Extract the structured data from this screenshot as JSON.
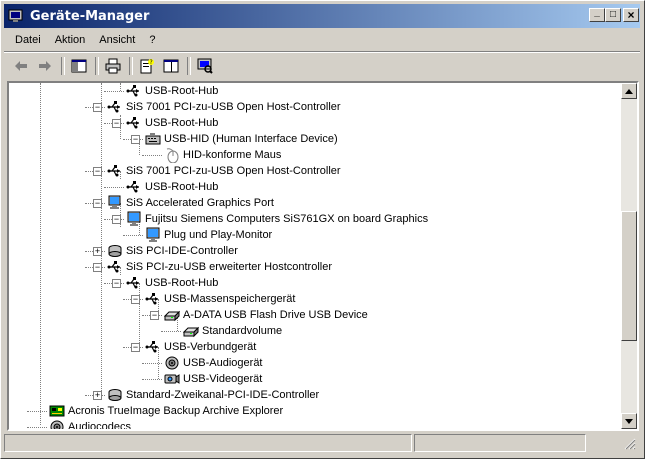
{
  "window": {
    "title": "Geräte-Manager"
  },
  "window_buttons": {
    "minimize": "_",
    "maximize": "□",
    "close": "×"
  },
  "menu": [
    "Datei",
    "Aktion",
    "Ansicht",
    "?"
  ],
  "toolbar": {
    "buttons": [
      "back-arrow-icon",
      "forward-arrow-icon",
      "show-hide-console-tree-icon",
      "print-icon",
      "properties-icon",
      "help-icon",
      "scan-hardware-icon"
    ]
  },
  "tree": {
    "rows": [
      {
        "label": "USB-Root-Hub",
        "icon": "usb-icon"
      },
      {
        "label": "SiS 7001 PCI-zu-USB Open Host-Controller",
        "icon": "usb-icon"
      },
      {
        "label": "USB-Root-Hub",
        "icon": "usb-icon"
      },
      {
        "label": "USB-HID (Human Interface Device)",
        "icon": "hid-icon"
      },
      {
        "label": "HID-konforme Maus",
        "icon": "mouse-icon"
      },
      {
        "label": "SiS 7001 PCI-zu-USB Open Host-Controller",
        "icon": "usb-icon"
      },
      {
        "label": "USB-Root-Hub",
        "icon": "usb-icon"
      },
      {
        "label": "SiS Accelerated Graphics Port",
        "icon": "agp-icon"
      },
      {
        "label": "Fujitsu Siemens Computers SiS761GX on board Graphics",
        "icon": "monitor-icon"
      },
      {
        "label": "Plug und Play-Monitor",
        "icon": "monitor-icon"
      },
      {
        "label": "SiS PCI-IDE-Controller",
        "icon": "ide-icon"
      },
      {
        "label": "SiS PCI-zu-USB erweiterter Hostcontroller",
        "icon": "usb-icon"
      },
      {
        "label": "USB-Root-Hub",
        "icon": "usb-icon"
      },
      {
        "label": "USB-Massenspeichergerät",
        "icon": "usb-icon"
      },
      {
        "label": "A-DATA USB Flash Drive USB Device",
        "icon": "drive-icon"
      },
      {
        "label": "Standardvolume",
        "icon": "drive-icon"
      },
      {
        "label": "USB-Verbundgerät",
        "icon": "usb-icon"
      },
      {
        "label": "USB-Audiogerät",
        "icon": "speaker-icon"
      },
      {
        "label": "USB-Videogerät",
        "icon": "camera-icon"
      },
      {
        "label": "Standard-Zweikanal-PCI-IDE-Controller",
        "icon": "ide-icon"
      },
      {
        "label": "Acronis TrueImage Backup Archive Explorer",
        "icon": "board-icon"
      },
      {
        "label": "Audiocodecs",
        "icon": "speaker-icon"
      }
    ]
  },
  "status": {
    "pane1": "",
    "pane2": ""
  }
}
